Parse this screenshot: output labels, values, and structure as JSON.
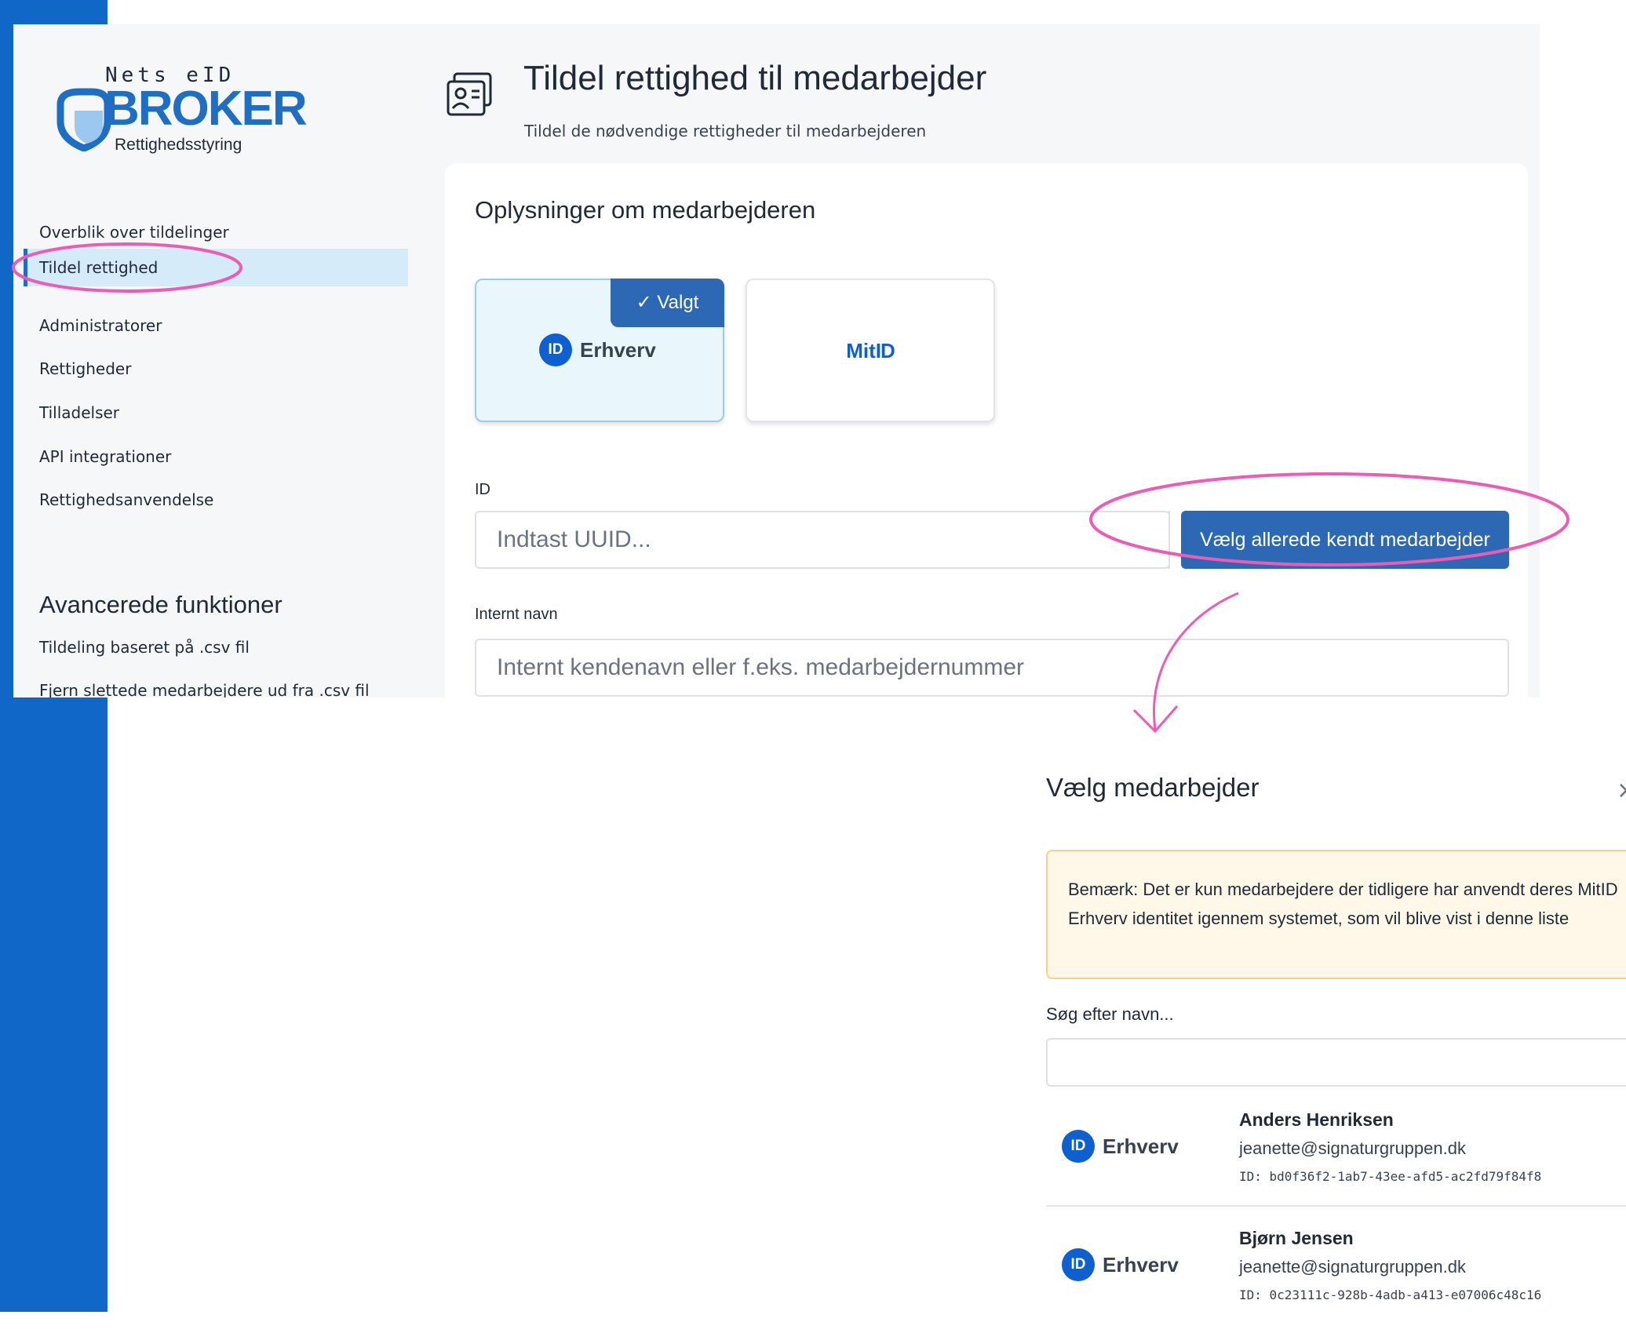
{
  "brand": {
    "top": "Nets eID",
    "main": "BROKER",
    "sub": "Rettighedsstyring"
  },
  "sidebar": {
    "items": [
      {
        "label": "Overblik over tildelinger"
      },
      {
        "label": "Tildel rettighed",
        "active": true
      },
      {
        "label": "Administratorer"
      },
      {
        "label": "Rettigheder"
      },
      {
        "label": "Tilladelser"
      },
      {
        "label": "API integrationer"
      },
      {
        "label": "Rettighedsanvendelse"
      }
    ],
    "advanced_title": "Avancerede funktioner",
    "advanced_items": [
      {
        "label": "Tildeling baseret på .csv fil"
      },
      {
        "label": "Fjern slettede medarbejdere ud fra .csv fil"
      }
    ]
  },
  "page": {
    "title": "Tildel rettighed til medarbejder",
    "subtitle": "Tildel de nødvendige rettigheder til medarbejderen"
  },
  "form": {
    "section_title": "Oplysninger om medarbejderen",
    "choice_selected_badge": "Valgt",
    "choice_erhverv_logo": "ID",
    "choice_erhverv_label": "Erhverv",
    "choice_mitid_label": "Mit",
    "choice_mitid_logo": "ID",
    "id_label": "ID",
    "id_placeholder": "Indtast UUID...",
    "pick_known_button": "Vælg allerede kendt medarbejder",
    "internal_name_label": "Internt navn",
    "internal_name_placeholder": "Internt kendenavn eller f.eks. medarbejdernummer"
  },
  "modal": {
    "title": "Vælg medarbejder",
    "close": "×",
    "notice": "Bemærk: Det er kun medarbejdere der tidligere har anvendt deres MitID Erhverv identitet igennem systemet, som vil blive vist i denne liste",
    "search_label": "Søg efter navn...",
    "search_value": "",
    "employees": [
      {
        "logo": "ID",
        "type": "Erhverv",
        "name": "Anders Henriksen",
        "email": "jeanette@signaturgruppen.dk",
        "id": "ID: bd0f36f2-1ab7-43ee-afd5-ac2fd79f84f8"
      },
      {
        "logo": "ID",
        "type": "Erhverv",
        "name": "Bjørn Jensen",
        "email": "jeanette@signaturgruppen.dk",
        "id": "ID: 0c23111c-928b-4adb-a413-e07006c48c16"
      }
    ]
  },
  "colors": {
    "brand_blue": "#1067c7",
    "button_blue": "#2c68b3",
    "active_nav_bg": "#d5ebfa",
    "annotation_pink": "#ee5bb5",
    "notice_bg": "#fff8e8"
  }
}
